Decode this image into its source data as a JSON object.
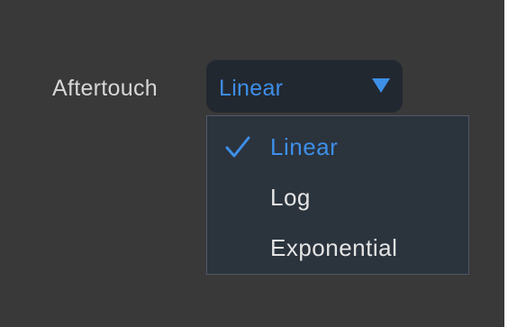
{
  "aftertouch": {
    "label": "Aftertouch",
    "selected_value": "Linear",
    "options": [
      {
        "label": "Linear",
        "selected": true
      },
      {
        "label": "Log",
        "selected": false
      },
      {
        "label": "Exponential",
        "selected": false
      }
    ]
  },
  "colors": {
    "panel_background": "#393939",
    "select_background": "#222830",
    "menu_background": "#2b333d",
    "accent": "#3d8fe8",
    "text": "#d6d6d6"
  },
  "icons": {
    "caret": "caret-down-icon",
    "check": "checkmark-icon"
  }
}
